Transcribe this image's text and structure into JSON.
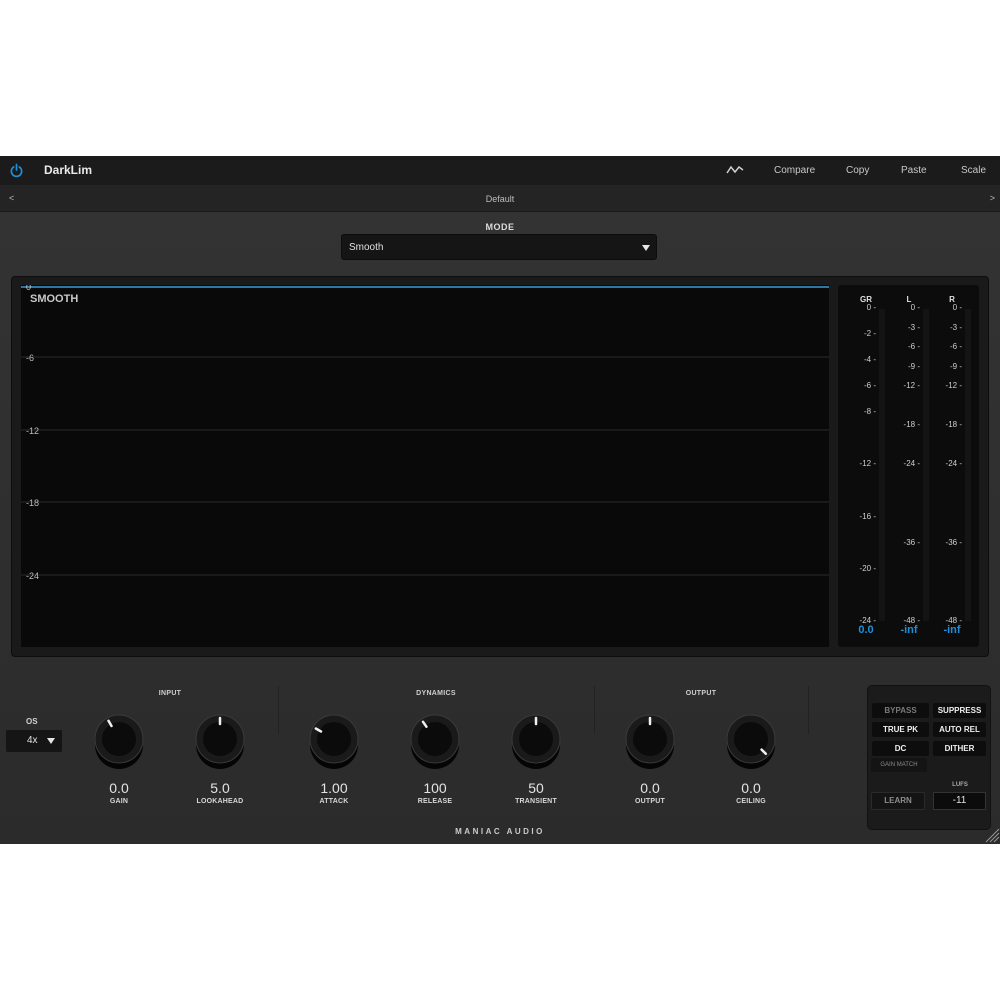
{
  "host": {
    "plugin_name": "DarkLim",
    "buttons": [
      "Compare",
      "Copy",
      "Paste",
      "Scale"
    ],
    "preset": {
      "prev": "<",
      "name": "Default",
      "next": ">"
    }
  },
  "mode": {
    "label": "MODE",
    "value": "Smooth"
  },
  "graph": {
    "mode_text": "SMOOTH",
    "y_labels": [
      "0",
      "-6",
      "-12",
      "-18",
      "-24"
    ],
    "line_color": "#3a9ad9"
  },
  "meters": {
    "headers": [
      "GR",
      "L",
      "R"
    ],
    "gr_scale": [
      "0",
      "-2",
      "-4",
      "-6",
      "-8",
      "-12",
      "-16",
      "-20",
      "-24"
    ],
    "lr_scale": [
      "0",
      "-3",
      "-6",
      "-9",
      "-12",
      "-18",
      "-24",
      "-36",
      "-48"
    ],
    "readouts": {
      "gr": "0.0",
      "l": "-inf",
      "r": "-inf"
    },
    "readout_color": "#1e8fd8"
  },
  "os": {
    "label": "OS",
    "value": "4x"
  },
  "sections": {
    "input": "INPUT",
    "dynamics": "DYNAMICS",
    "output": "OUTPUT"
  },
  "knobs": [
    {
      "id": "gain",
      "value": "0.0",
      "label": "GAIN",
      "indicator_deg": -30
    },
    {
      "id": "lookahead",
      "value": "5.0",
      "label": "LOOKAHEAD",
      "indicator_deg": 0
    },
    {
      "id": "attack",
      "value": "1.00",
      "label": "ATTACK",
      "indicator_deg": -60
    },
    {
      "id": "release",
      "value": "100",
      "label": "RELEASE",
      "indicator_deg": -35
    },
    {
      "id": "transient",
      "value": "50",
      "label": "TRANSIENT",
      "indicator_deg": 0
    },
    {
      "id": "output",
      "value": "0.0",
      "label": "OUTPUT",
      "indicator_deg": 0
    },
    {
      "id": "ceiling",
      "value": "0.0",
      "label": "CEILING",
      "indicator_deg": 135
    }
  ],
  "toggles": {
    "bypass": "BYPASS",
    "suppress": "SUPPRESS",
    "true_pk": "TRUE PK",
    "auto_rel": "AUTO REL",
    "dc": "DC",
    "dither": "DITHER",
    "gain_match": "GAIN MATCH",
    "learn": "LEARN",
    "lufs_label": "LUFS",
    "lufs_value": "-11"
  },
  "brand": "MANIAC AUDIO",
  "accent_color": "#1e8fd8"
}
